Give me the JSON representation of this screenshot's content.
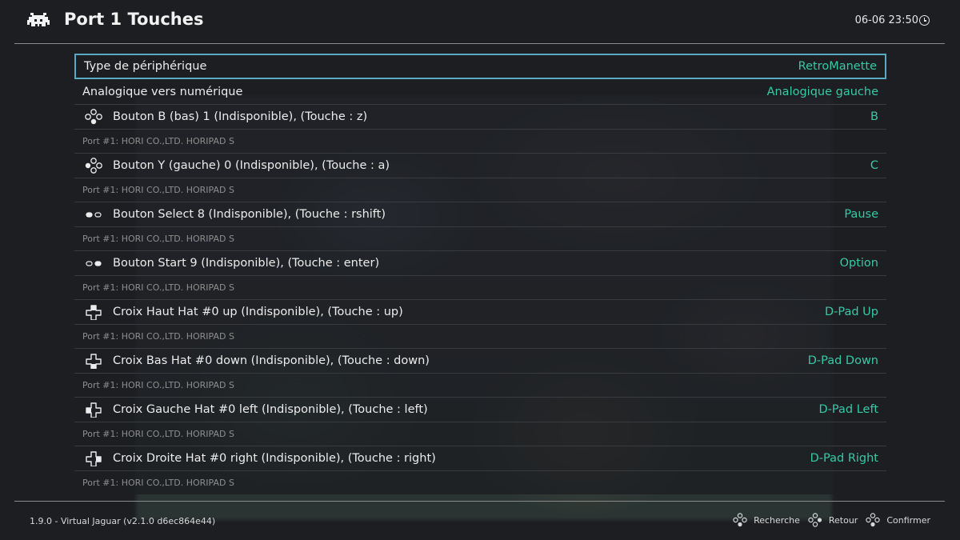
{
  "header": {
    "title": "Port 1 Touches",
    "clock": "06-06 23:50",
    "logo_icon": "retroarch-invader-icon"
  },
  "settings": [
    {
      "label": "Type de périphérique",
      "value": "RetroManette",
      "selected": true
    },
    {
      "label": "Analogique vers numérique",
      "value": "Analogique gauche",
      "selected": false
    }
  ],
  "bindings": [
    {
      "icon": "face-buttons-bottom-icon",
      "label": "Bouton B (bas) 1 (Indisponible), (Touche : z)",
      "value": "B",
      "port": "Port #1: HORI CO.,LTD. HORIPAD S"
    },
    {
      "icon": "face-buttons-left-icon",
      "label": "Bouton Y (gauche) 0 (Indisponible), (Touche : a)",
      "value": "C",
      "port": "Port #1: HORI CO.,LTD. HORIPAD S"
    },
    {
      "icon": "select-button-icon",
      "label": "Bouton Select 8 (Indisponible), (Touche : rshift)",
      "value": "Pause",
      "port": "Port #1: HORI CO.,LTD. HORIPAD S"
    },
    {
      "icon": "start-button-icon",
      "label": "Bouton Start 9 (Indisponible), (Touche : enter)",
      "value": "Option",
      "port": "Port #1: HORI CO.,LTD. HORIPAD S"
    },
    {
      "icon": "dpad-up-icon",
      "label": "Croix Haut Hat #0 up (Indisponible), (Touche : up)",
      "value": "D-Pad Up",
      "port": "Port #1: HORI CO.,LTD. HORIPAD S"
    },
    {
      "icon": "dpad-down-icon",
      "label": "Croix Bas Hat #0 down (Indisponible), (Touche : down)",
      "value": "D-Pad Down",
      "port": "Port #1: HORI CO.,LTD. HORIPAD S"
    },
    {
      "icon": "dpad-left-icon",
      "label": "Croix Gauche Hat #0 left (Indisponible), (Touche : left)",
      "value": "D-Pad Left",
      "port": "Port #1: HORI CO.,LTD. HORIPAD S"
    },
    {
      "icon": "dpad-right-icon",
      "label": "Croix Droite Hat #0 right (Indisponible), (Touche : right)",
      "value": "D-Pad Right",
      "port": "Port #1: HORI CO.,LTD. HORIPAD S"
    }
  ],
  "footer": {
    "version": "1.9.0 - Virtual Jaguar (v2.1.0 d6ec864e44)",
    "help": [
      {
        "icon": "face-buttons-icon",
        "label": "Recherche"
      },
      {
        "icon": "face-buttons-icon",
        "label": "Retour"
      },
      {
        "icon": "face-buttons-icon",
        "label": "Confirmer"
      }
    ]
  },
  "colors": {
    "background": "#1d1e22",
    "accent_value": "#37c9a6",
    "selection_border": "#59a9c4",
    "sublabel": "#8e8e8e"
  }
}
